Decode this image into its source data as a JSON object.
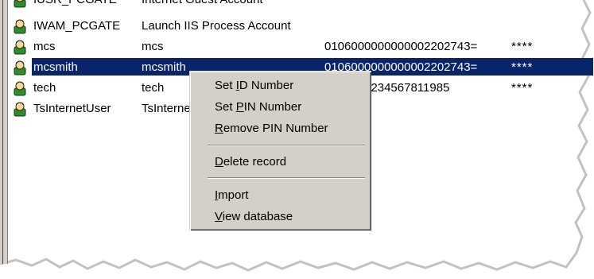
{
  "rows": [
    {
      "name": "IUSR_PCGATE",
      "description": "Internet Guest Account",
      "id_number": "",
      "pin": ""
    },
    {
      "name": "IWAM_PCGATE",
      "description": "Launch IIS Process Account",
      "id_number": "",
      "pin": ""
    },
    {
      "name": "mcs",
      "description": "mcs",
      "id_number": "0106000000000002202743=",
      "pin": "****"
    },
    {
      "name": "mcsmith",
      "description": "mcsmith",
      "id_number": "0106000000000002202743=",
      "pin": "****"
    },
    {
      "name": "tech",
      "description": "tech",
      "id_number": "6015991234567811985",
      "pin": "****"
    },
    {
      "name": "TsInternetUser",
      "description": "TsInternetUser",
      "id_number": "",
      "pin": ""
    }
  ],
  "selected_row": "mcsmith",
  "context_menu": {
    "set_id": {
      "pre": "Set ",
      "key": "I",
      "post": "D Number"
    },
    "set_pin": {
      "pre": "Set ",
      "key": "P",
      "post": "IN Number"
    },
    "remove_pin": {
      "pre": "",
      "key": "R",
      "post": "emove PIN Number"
    },
    "delete": {
      "pre": "",
      "key": "D",
      "post": "elete record"
    },
    "import": {
      "pre": "",
      "key": "I",
      "post": "mport"
    },
    "view_db": {
      "pre": "",
      "key": "V",
      "post": "iew database"
    }
  },
  "colors": {
    "selection": "#0a246a",
    "menu_bg": "#d4d0c8",
    "icon_green": "#2e8b2e"
  },
  "icons": {
    "user": "user-icon"
  }
}
